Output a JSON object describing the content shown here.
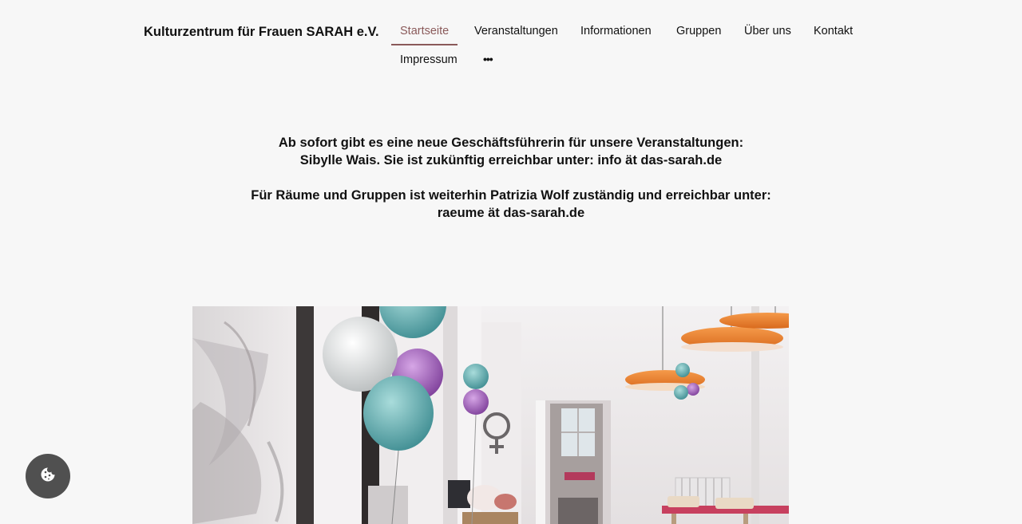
{
  "header": {
    "brand": "Kulturzentrum für Frauen SARAH e.V.",
    "nav": {
      "startseite": "Startseite",
      "veranstaltungen": "Veranstaltungen",
      "informationen": "Informationen",
      "gruppen": "Gruppen",
      "ueber_uns": "Über uns",
      "kontakt": "Kontakt",
      "impressum": "Impressum",
      "more": "•••"
    },
    "active_item": "Startseite",
    "accent_color": "#8a5a5a"
  },
  "announcement": {
    "line1": "Ab sofort gibt es eine neue Geschäftsführerin für unsere Veranstaltungen:",
    "line2": "Sibylle Wais. Sie ist zukünftig erreichbar unter: info ät das-sarah.de",
    "line3": "Für Räume und Gruppen ist weiterhin Patrizia Wolf zuständig und erreichbar unter:",
    "line4": "raeume ät das-sarah.de"
  },
  "hero_image": {
    "subject": "room interior with balloons and orange pendant lamps"
  },
  "cookie_button": {
    "icon": "cookie-icon"
  }
}
